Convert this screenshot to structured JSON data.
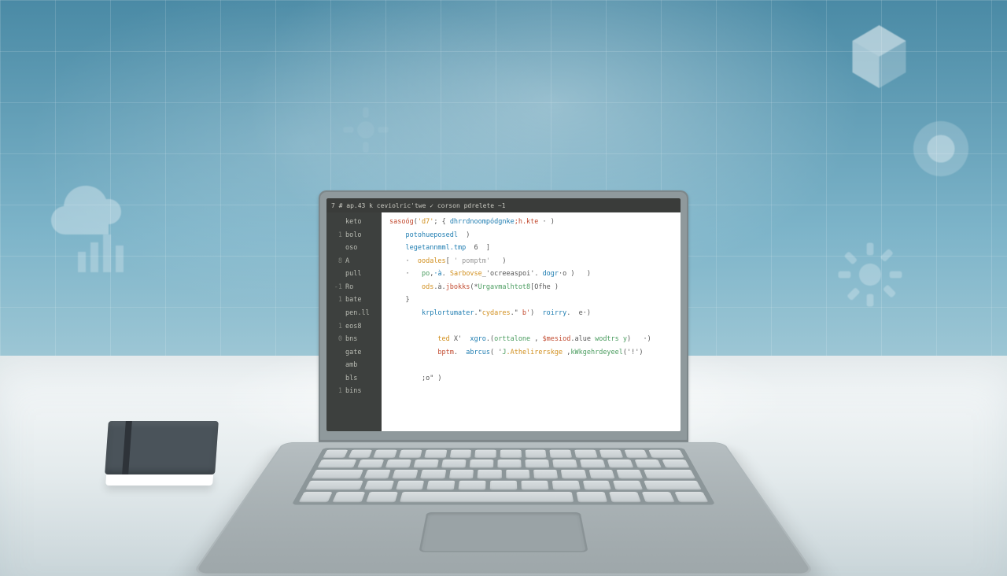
{
  "scene": "Stylized illustration of a silver laptop on a white desk showing a code editor, with a small dark notebook beside it and faint tech icons on a teal grid background.",
  "titlebar": {
    "prompt": "7 #  ap.43 k  ceviolric'twe ✓  corson  pdrelete  ~1"
  },
  "gutter_rows": [
    {
      "num": "",
      "tag": "keto"
    },
    {
      "num": "1",
      "tag": "bolo"
    },
    {
      "num": "",
      "tag": "oso"
    },
    {
      "num": "8",
      "tag": "A"
    },
    {
      "num": "",
      "tag": "pull"
    },
    {
      "num": "-1",
      "tag": "Ro"
    },
    {
      "num": "",
      "tag": ""
    },
    {
      "num": "1",
      "tag": "bate"
    },
    {
      "num": "",
      "tag": "pen.ll"
    },
    {
      "num": "",
      "tag": ""
    },
    {
      "num": "1",
      "tag": "eos8"
    },
    {
      "num": "",
      "tag": ""
    },
    {
      "num": "0",
      "tag": "bns"
    },
    {
      "num": "",
      "tag": "gate"
    },
    {
      "num": "",
      "tag": "amb"
    },
    {
      "num": "",
      "tag": "bls"
    },
    {
      "num": "1",
      "tag": "bins"
    }
  ],
  "code_lines": [
    {
      "indent": 0,
      "segs": [
        [
          "str",
          "sasoóg"
        ],
        [
          "op",
          "("
        ],
        [
          "fn",
          "'d7'"
        ],
        [
          "op",
          "; { "
        ],
        [
          "kw",
          "dhrrdnoompódgnke"
        ],
        [
          "str",
          ";h.kte"
        ],
        [
          "op",
          " · )"
        ]
      ]
    },
    {
      "indent": 1,
      "segs": [
        [
          "kw",
          "potohueposedl"
        ],
        [
          "op",
          "  )"
        ]
      ]
    },
    {
      "indent": 1,
      "segs": [
        [
          "kw",
          "legetannmml.tmp"
        ],
        [
          "op",
          "  6  ]"
        ]
      ]
    },
    {
      "indent": 1,
      "segs": [
        [
          "op",
          "·  "
        ],
        [
          "fn",
          "oodales"
        ],
        [
          "op",
          "[ "
        ],
        [
          "comm",
          "' pomptm'"
        ],
        [
          "op",
          "   )"
        ]
      ]
    },
    {
      "indent": 1,
      "segs": [
        [
          "op",
          "·   "
        ],
        [
          "var",
          "po"
        ],
        [
          "op",
          ","
        ],
        [
          "kw",
          "·à"
        ],
        [
          "op",
          ". "
        ],
        [
          "fn",
          "Sarbovse"
        ],
        [
          "op",
          "_'ocreeaspoi'. "
        ],
        [
          "kw",
          "dogr"
        ],
        [
          "op",
          "·o )   )"
        ]
      ]
    },
    {
      "indent": 2,
      "segs": [
        [
          "fn",
          "ods"
        ],
        [
          "op",
          ".à."
        ],
        [
          "str",
          "jbokks"
        ],
        [
          "op",
          "(*"
        ],
        [
          "var",
          "Urgavmalhtot8"
        ],
        [
          "op",
          "[Ofhe )"
        ]
      ]
    },
    {
      "indent": 1,
      "segs": [
        [
          "op",
          "}"
        ]
      ]
    },
    {
      "indent": 2,
      "segs": [
        [
          "kw",
          "krplortumater"
        ],
        [
          "op",
          ".\""
        ],
        [
          "fn",
          "cydares"
        ],
        [
          "op",
          ".\" "
        ],
        [
          "str",
          "b'"
        ],
        [
          "op",
          ")  "
        ],
        [
          "kw",
          "roirry"
        ],
        [
          "op",
          ".  e·)"
        ]
      ]
    },
    {
      "indent": 0,
      "segs": [
        [
          "op",
          " "
        ]
      ]
    },
    {
      "indent": 3,
      "segs": [
        [
          "fn",
          "ted"
        ],
        [
          "op",
          " X'  "
        ],
        [
          "kw",
          "xgro"
        ],
        [
          "op",
          ".("
        ],
        [
          "var",
          "orttalone"
        ],
        [
          "op",
          " , "
        ],
        [
          "str",
          "$mesiod"
        ],
        [
          "op",
          ".alue "
        ],
        [
          "var",
          "wodtrs y"
        ],
        [
          "op",
          ")   ·)"
        ]
      ]
    },
    {
      "indent": 3,
      "segs": [
        [
          "str",
          "bptm"
        ],
        [
          "op",
          ".  "
        ],
        [
          "kw",
          "abrcus"
        ],
        [
          "op",
          "( '"
        ],
        [
          "var",
          "J"
        ],
        [
          "fn",
          ".Athelirerskge"
        ],
        [
          "op",
          " ,"
        ],
        [
          "var",
          "kWkgehrdeyeel"
        ],
        [
          "op",
          "('!')"
        ]
      ]
    },
    {
      "indent": 0,
      "segs": [
        [
          "op",
          " "
        ]
      ]
    },
    {
      "indent": 2,
      "segs": [
        [
          "op",
          ";o\" )"
        ]
      ]
    }
  ]
}
